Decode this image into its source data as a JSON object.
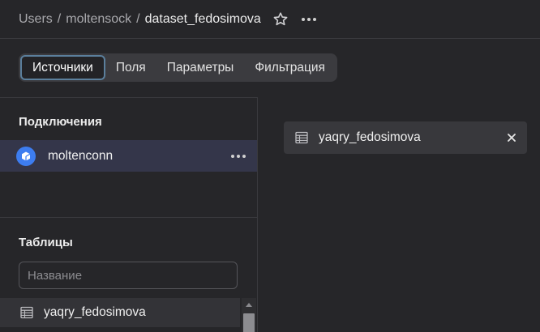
{
  "breadcrumb": {
    "items": [
      "Users",
      "moltensock"
    ],
    "current": "dataset_fedosimova",
    "separator": "/"
  },
  "tabs": [
    {
      "label": "Источники",
      "active": true
    },
    {
      "label": "Поля",
      "active": false
    },
    {
      "label": "Параметры",
      "active": false
    },
    {
      "label": "Фильтрация",
      "active": false
    }
  ],
  "connections": {
    "title": "Подключения",
    "items": [
      {
        "label": "moltenconn",
        "icon": "connection-icon"
      }
    ]
  },
  "tables": {
    "title": "Таблицы",
    "search_placeholder": "Название",
    "items": [
      {
        "label": "yaqry_fedosimova",
        "icon": "table-icon"
      }
    ]
  },
  "selected_sources": [
    {
      "label": "yaqry_fedosimova",
      "icon": "table-icon"
    }
  ],
  "colors": {
    "background": "#262629",
    "accent": "#3d7df0",
    "active_tab_border": "#5b7f9c"
  }
}
